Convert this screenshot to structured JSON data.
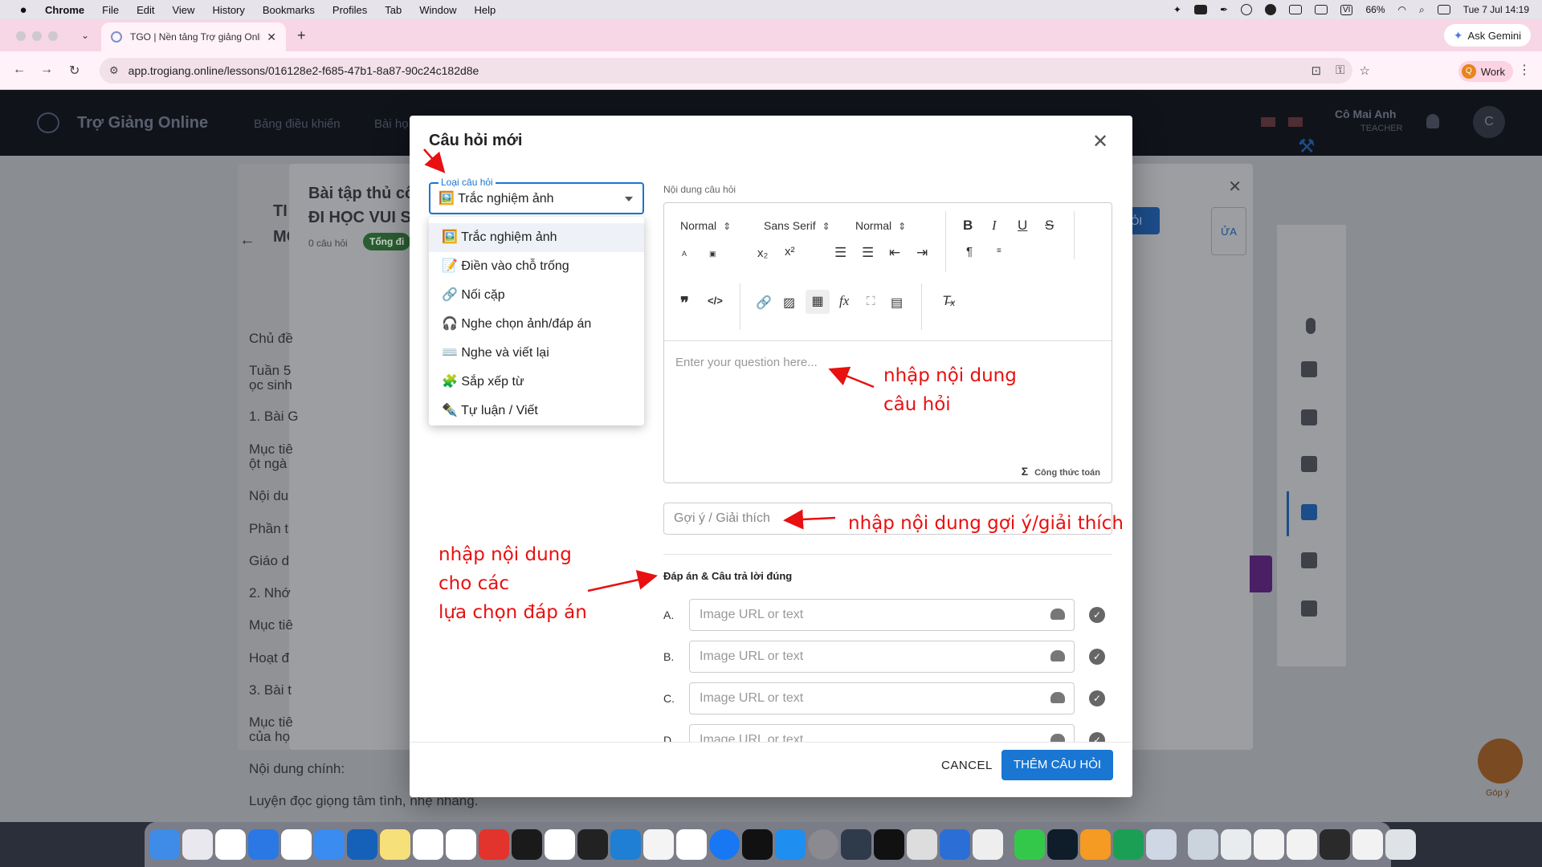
{
  "menubar": {
    "app": "Chrome",
    "items": [
      "File",
      "Edit",
      "View",
      "History",
      "Bookmarks",
      "Profiles",
      "Tab",
      "Window",
      "Help"
    ],
    "battery": "66%",
    "datetime": "Tue 7 Jul  14:19",
    "lang": "VI"
  },
  "browser": {
    "tab_title": "TGO | Nền tảng Trợ giảng Onli",
    "url": "app.trogiang.online/lessons/016128e2-f685-47b1-8a87-90c24c182d8e",
    "ask_gemini": "Ask Gemini",
    "profile": "Work",
    "profile_initial": "Q"
  },
  "app": {
    "brand": "Trợ Giảng Online",
    "nav": [
      "Bảng điều khiển",
      "Bài họ"
    ],
    "user_name": "Cô Mai Anh",
    "user_role": "TEACHER",
    "avatar": "C"
  },
  "background": {
    "title1": "Bài tập thủ cô",
    "title2": "ĐI HỌC VUI S",
    "left_title1": "TI",
    "left_title2": "MO",
    "count": "0 câu hỏi",
    "pill": "Tổng đi",
    "add_button": "ÂU HỎI",
    "tab_partial": "ỬA",
    "content": [
      "Chủ đề",
      "Tuần 5",
      "ọc sinh",
      "1. Bài G",
      "Mục tiê",
      "ột ngà",
      "Nội du",
      "Phần t",
      "Giáo d",
      "2. Nhớ",
      "Mục tiê",
      "Hoạt đ",
      "3. Bài t",
      "Mục tiê",
      " của họ",
      "Nội dung chính:",
      "Luyện đọc giọng tâm tình, nhẹ nhàng."
    ],
    "fab_label": "Góp ý"
  },
  "modal": {
    "title": "Câu hỏi mới",
    "type_label": "Loại câu hỏi",
    "type_value": "🖼️ Trắc nghiệm ảnh",
    "options": [
      "🖼️ Trắc nghiệm ảnh",
      "📝 Điền vào chỗ trống",
      "🔗 Nối cặp",
      "🎧 Nghe chọn ảnh/đáp án",
      "⌨️ Nghe và viết lại",
      "🧩 Sắp xếp từ",
      "✒️ Tự luận / Viết"
    ],
    "content_label": "Nội dung câu hỏi",
    "toolbar": {
      "heading": "Normal",
      "font": "Sans Serif",
      "size": "Normal"
    },
    "editor_placeholder": "Enter your question here...",
    "formula": "Công thức toán",
    "hint_placeholder": "Gợi ý / Giải thích",
    "answers_label": "Đáp án & Câu trả lời đúng",
    "answers": [
      {
        "letter": "A.",
        "placeholder": "Image URL or text"
      },
      {
        "letter": "B.",
        "placeholder": "Image URL or text"
      },
      {
        "letter": "C.",
        "placeholder": "Image URL or text"
      },
      {
        "letter": "D.",
        "placeholder": "Image URL or text"
      }
    ],
    "cancel": "CANCEL",
    "submit": "THÊM CÂU HỎI"
  },
  "annotations": {
    "question_line1": "nhập nội dung",
    "question_line2": "câu hỏi",
    "hint": "nhập nội dung gợi ý/giải thích",
    "answers_line1": "nhập nội dung",
    "answers_line2": "cho các",
    "answers_line3": "lựa chọn đáp án"
  },
  "colors": {
    "primary": "#1976d2",
    "annotation": "#e81010",
    "tabstrip": "#f7d6e6"
  }
}
